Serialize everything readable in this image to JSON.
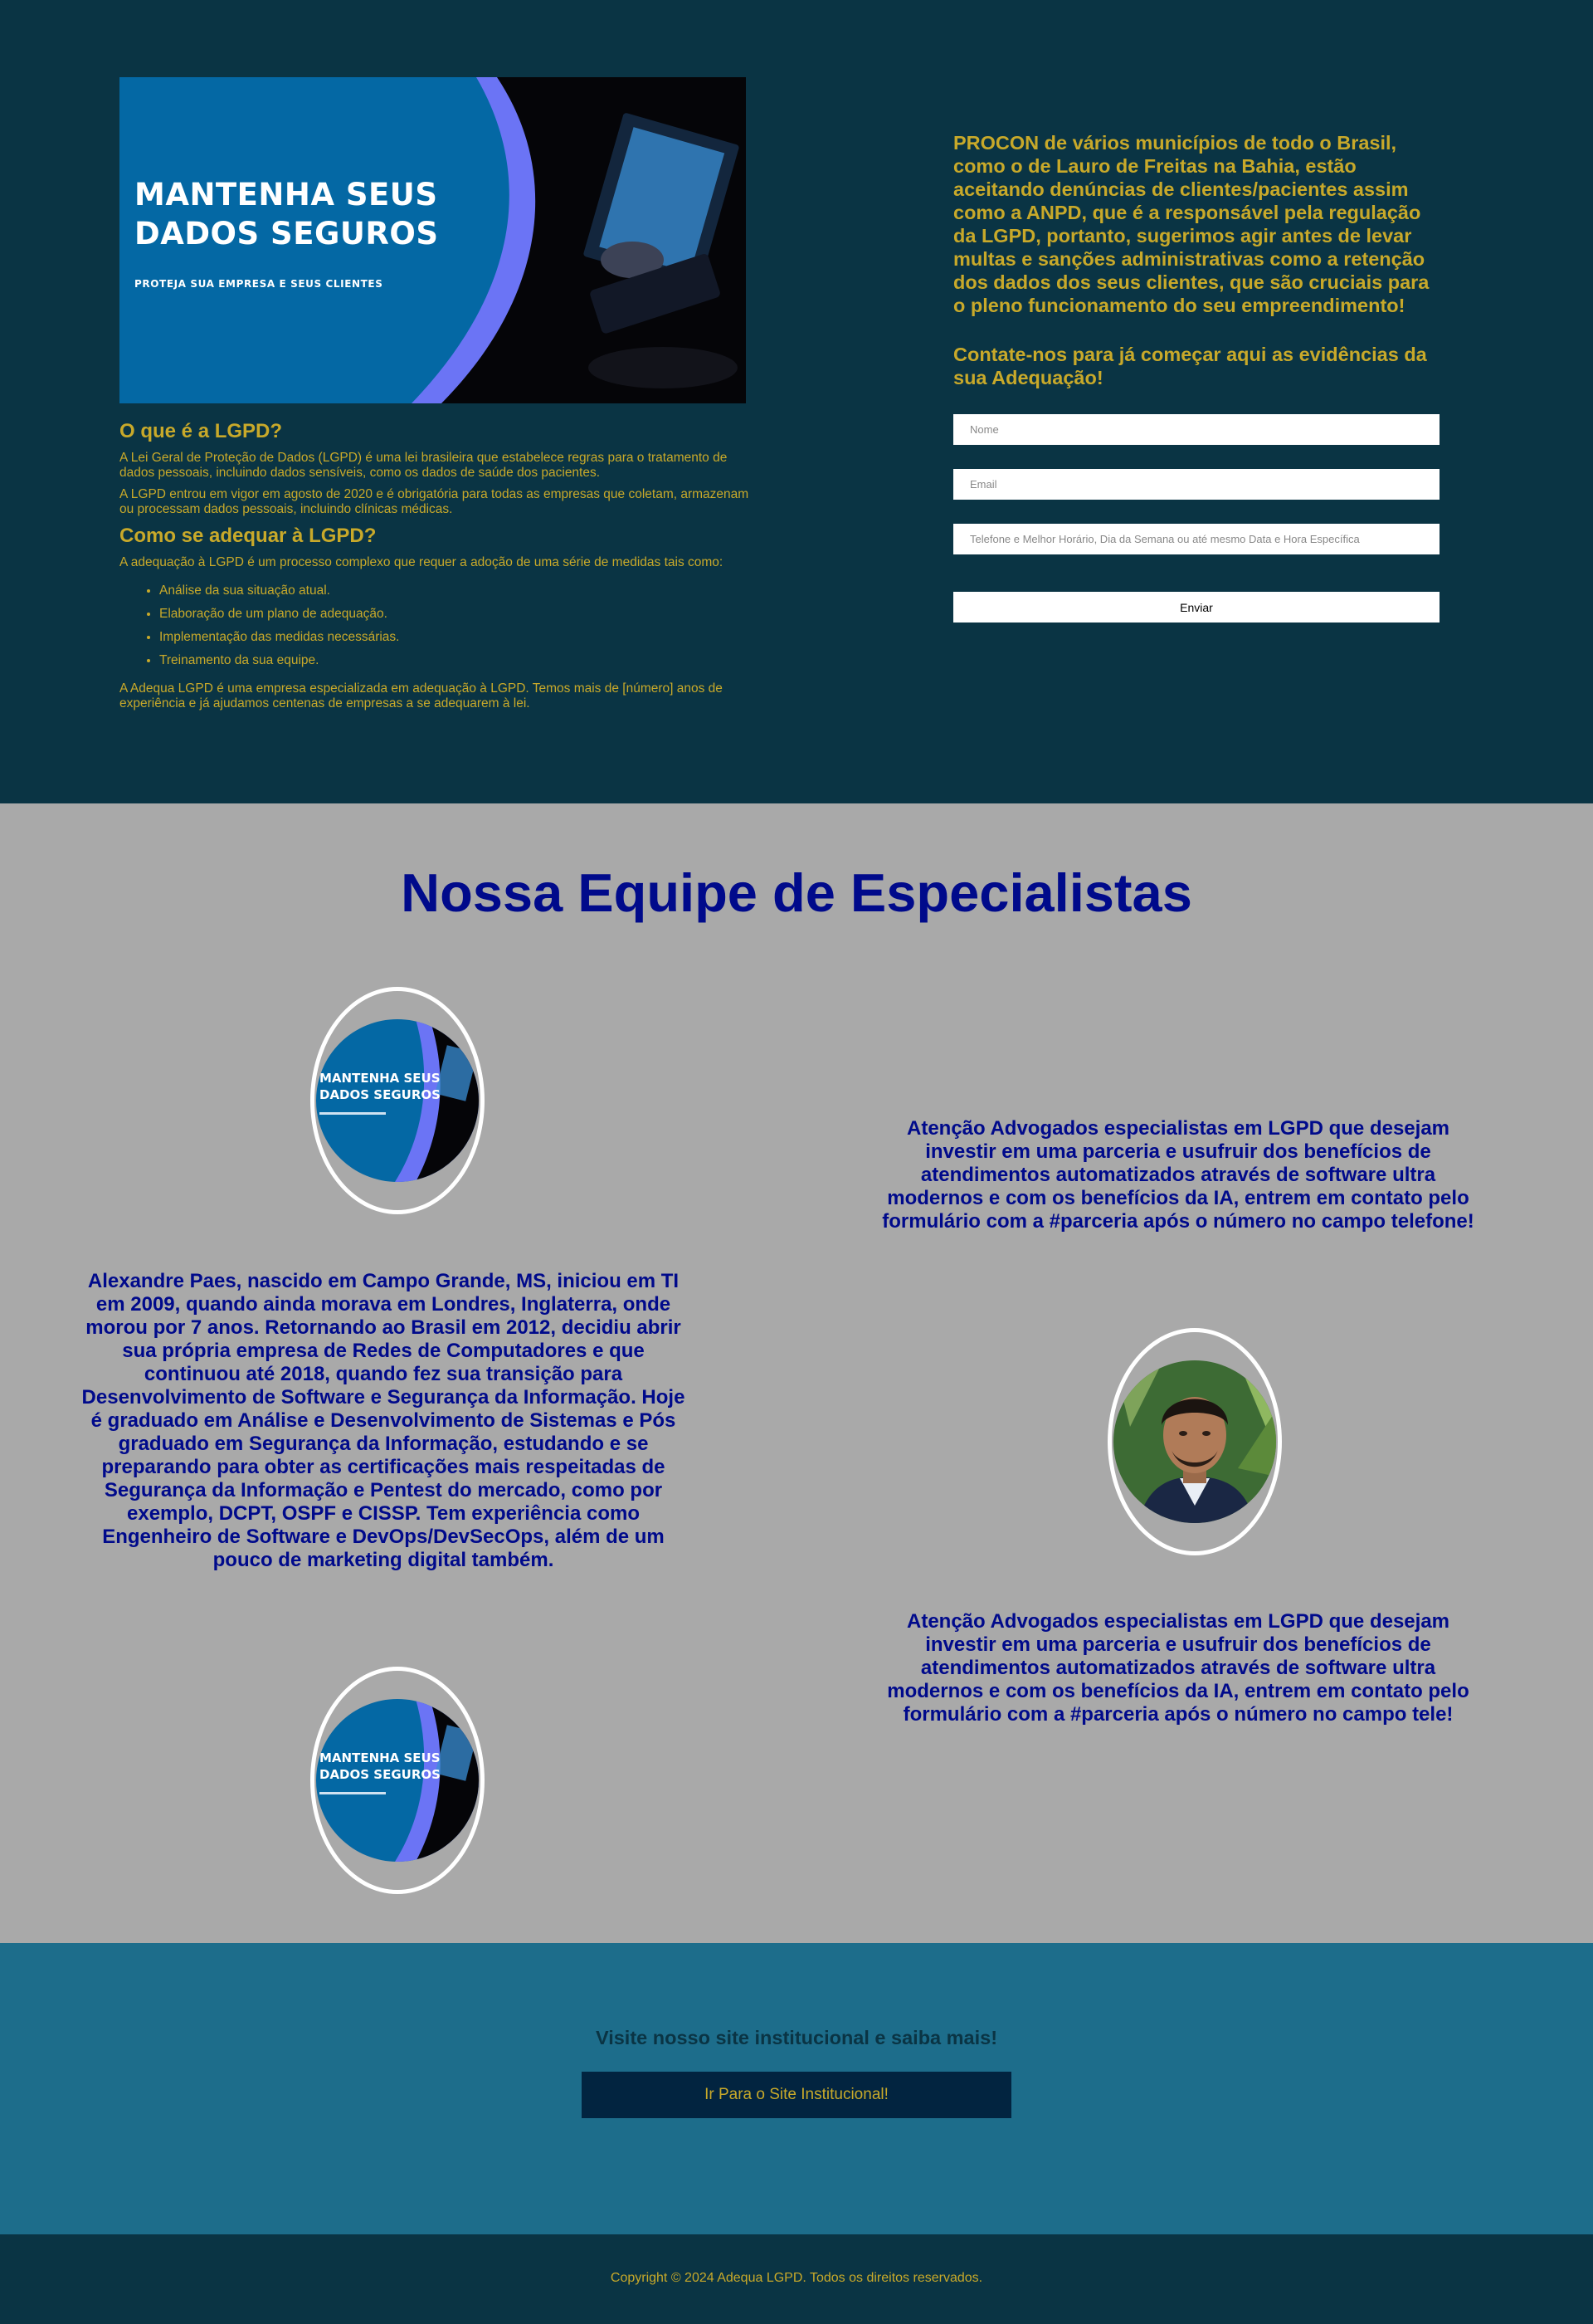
{
  "hero": {
    "headline_line1": "MANTENHA SEUS",
    "headline_line2": "DADOS SEGUROS",
    "subline": "PROTEJA SUA EMPRESA E SEUS CLIENTES"
  },
  "lgpd": {
    "title1": "O que é a LGPD?",
    "p1": "A Lei Geral de Proteção de Dados (LGPD) é uma lei brasileira que estabelece regras para o tratamento de dados pessoais, incluindo dados sensíveis, como os dados de saúde dos pacientes.",
    "p2": "A LGPD entrou em vigor em agosto de 2020 e é obrigatória para todas as empresas que coletam, armazenam ou processam dados pessoais, incluindo clínicas médicas.",
    "title2": "Como se adequar à LGPD?",
    "p3": "A adequação à LGPD é um processo complexo que requer a adoção de uma série de medidas tais como:",
    "items": [
      "Análise da sua situação atual.",
      "Elaboração de um plano de adequação.",
      "Implementação das medidas necessárias.",
      "Treinamento da sua equipe."
    ],
    "p4": "A Adequa LGPD é uma empresa especializada em adequação à LGPD. Temos mais de [número] anos de experiência e já ajudamos centenas de empresas a se adequarem à lei."
  },
  "contact": {
    "intro": "PROCON de vários municípios de todo o Brasil, como o de Lauro de Freitas na Bahia, estão aceitando denúncias de clientes/pacientes assim como a ANPD, que é a responsável pela regulação da LGPD, portanto, sugerimos agir antes de levar multas e sanções administrativas como a retenção dos dados dos seus clientes, que são cruciais para o pleno funcionamento do seu empreendimento!",
    "cta": "Contate-nos para já começar aqui as evidências da sua Adequação!",
    "name_placeholder": "Nome",
    "email_placeholder": "Email",
    "phone_placeholder": "Telefone e Melhor Horário, Dia da Semana ou até mesmo Data e Hora Específica",
    "send_label": "Enviar"
  },
  "team": {
    "title": "Nossa Equipe de Especialistas",
    "attention1": "Atenção Advogados especialistas em LGPD que desejam investir em uma parceria e usufruir dos benefícios de atendimentos automatizados através de software ultra modernos e com os benefícios da IA, entrem em contato pelo formulário com a #parceria após o número no campo telefone!",
    "bio": "Alexandre Paes, nascido em Campo Grande, MS, iniciou em TI em 2009, quando ainda morava em Londres, Inglaterra, onde morou por 7 anos. Retornando ao Brasil em 2012, decidiu abrir sua própria empresa de Redes de Computadores e que continuou até 2018, quando fez sua transição para Desenvolvimento de Software e Segurança da Informação. Hoje é graduado em Análise e Desenvolvimento de Sistemas e Pós graduado em Segurança da Informação, estudando e se preparando para obter as certificações mais respeitadas de Segurança da Informação e Pentest do mercado, como por exemplo, DCPT, OSPF e CISSP. Tem experiência como Engenheiro de Software e DevOps/DevSecOps, além de um pouco de marketing digital também.",
    "attention2": "Atenção Advogados especialistas em LGPD que desejam investir em uma parceria e usufruir dos benefícios de atendimentos automatizados através de software ultra modernos e com os benefícios da IA, entrem em contato pelo formulário com a #parceria após o número no campo tele!"
  },
  "institutional": {
    "title": "Visite nosso site institucional e saiba mais!",
    "button_label": "Ir Para o Site Institucional!"
  },
  "footer": {
    "copyright": "Copyright © 2024 Adequa LGPD. Todos os direitos reservados."
  },
  "colors": {
    "dark_bg": "#0a3444",
    "gold_text": "#c8a92a",
    "team_bg": "#a9a9a9",
    "navy_text": "#000a8b",
    "cta_bg": "#1d6d8b"
  }
}
